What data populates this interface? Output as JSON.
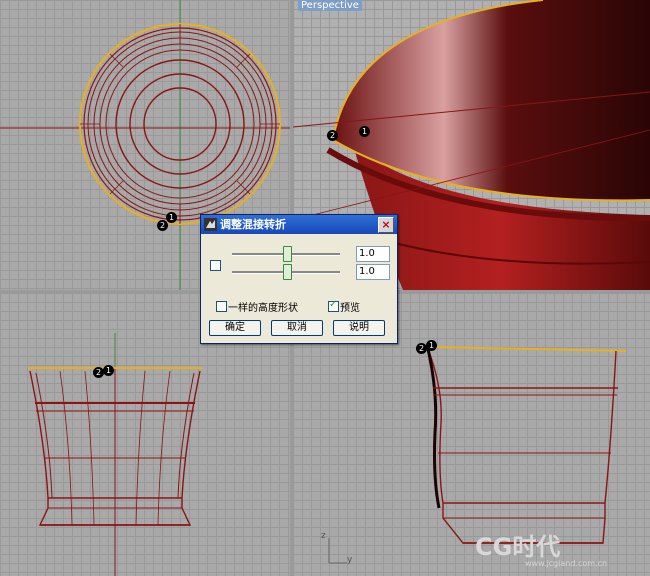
{
  "viewports": {
    "top_label": "",
    "perspective_label": "Perspective",
    "axis_z": "z",
    "axis_y": "y"
  },
  "point_markers": {
    "one": "1",
    "two": "2"
  },
  "dialog": {
    "title": "调整混接转折",
    "close_icon": "×",
    "slider1_value": 0.5,
    "slider2_value": 0.5,
    "input1_value": "1.0",
    "input2_value": "1.0",
    "same_height_label": "一样的高度形状",
    "same_height_checked": false,
    "preview_label": "预览",
    "preview_checked": true,
    "ok_label": "确定",
    "cancel_label": "取消",
    "help_label": "说明"
  },
  "watermark": {
    "text": "CG时代",
    "url": "www.jcgiand.com.cn"
  },
  "colors": {
    "curve": "#8a1414",
    "highlight": "#e8b020",
    "grid": "#999999",
    "viewport_bg": "#a9a9a9"
  }
}
